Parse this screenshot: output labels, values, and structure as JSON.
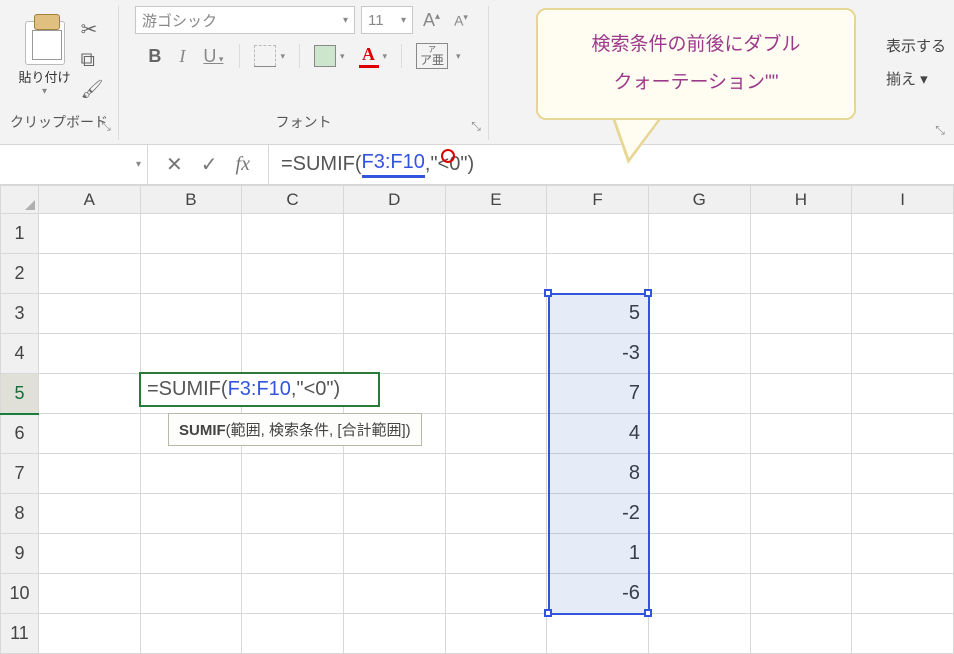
{
  "ribbon": {
    "clipboard": {
      "title": "クリップボード",
      "paste": "貼り付け",
      "cut_icon": "cut",
      "copy_icon": "copy",
      "painter_icon": "format-painter"
    },
    "font": {
      "title": "フォント",
      "name": "游ゴシック",
      "size": "11",
      "grow": "A",
      "shrink": "A",
      "bold": "B",
      "italic": "I",
      "underline": "U",
      "ruby_top": "ア亜",
      "ruby_small": "ア"
    },
    "right_cut": {
      "line1": "表示する",
      "line2": "揃え ▾"
    }
  },
  "callout": {
    "line1": "検索条件の前後にダブル",
    "line2": "クォーテーション\"\""
  },
  "formula_bar": {
    "namebox": "",
    "cancel": "✕",
    "enter": "✓",
    "fx": "fx",
    "prefix": "=SUMIF(",
    "range": "F3:F10",
    "suffix": ",\"<0\")"
  },
  "grid": {
    "columns": [
      "A",
      "B",
      "C",
      "D",
      "E",
      "F",
      "G",
      "H",
      "I"
    ],
    "rows": [
      "1",
      "2",
      "3",
      "4",
      "5",
      "6",
      "7",
      "8",
      "9",
      "10",
      "11"
    ],
    "active_row": "5"
  },
  "editing": {
    "prefix": "=SUMIF(",
    "range": "F3:F10",
    "suffix": ",\"<0\")"
  },
  "tooltip": {
    "fn": "SUMIF",
    "args": "(範囲, 検索条件, [合計範囲])"
  },
  "chart_data": {
    "type": "table",
    "range": "F3:F10",
    "values": [
      5,
      -3,
      7,
      4,
      8,
      -2,
      1,
      -6
    ]
  }
}
